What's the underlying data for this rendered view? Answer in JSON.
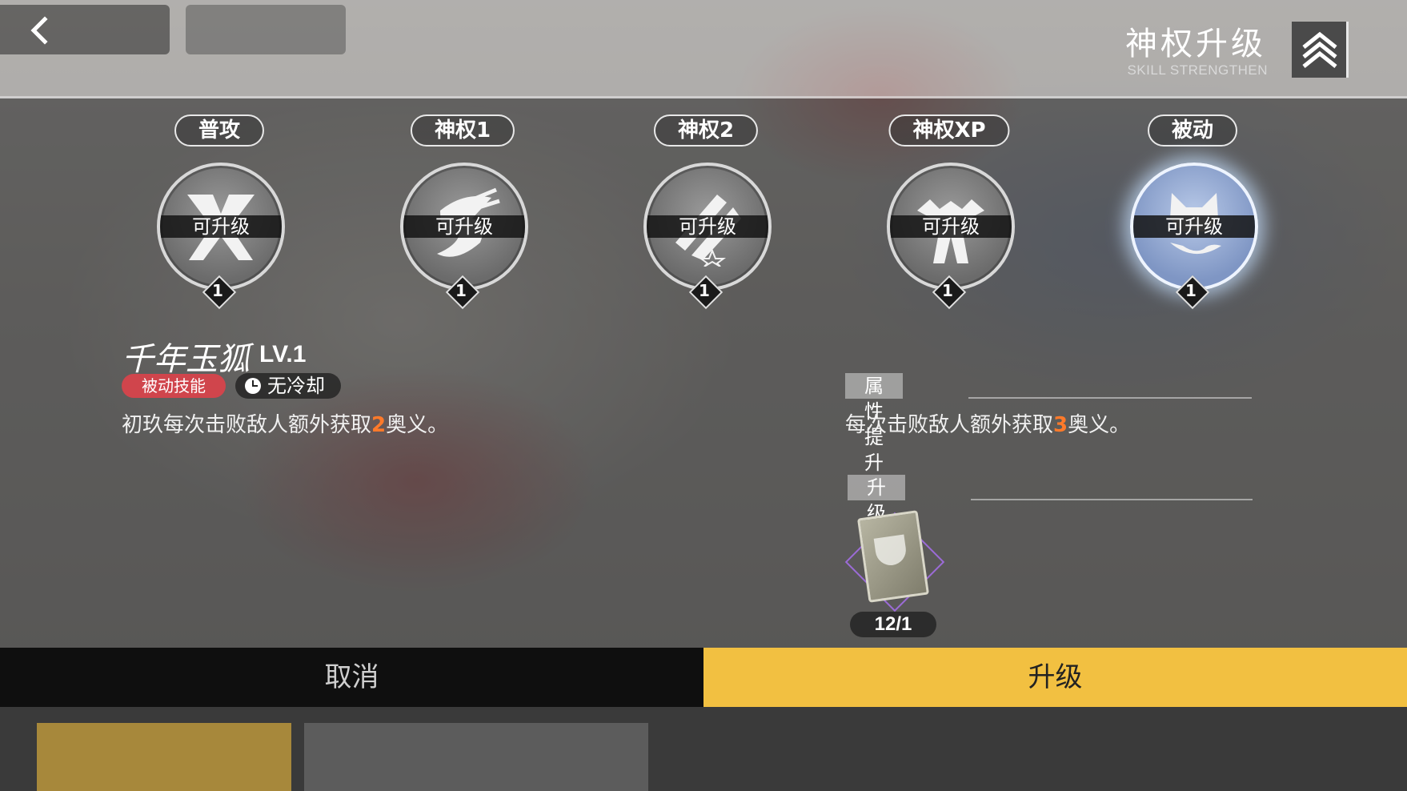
{
  "header": {
    "title": "神权升级",
    "subtitle": "SKILL STRENGTHEN"
  },
  "skills": [
    {
      "label": "普攻",
      "status": "可升级",
      "level": "1",
      "icon": "crossed-blades-icon"
    },
    {
      "label": "神权1",
      "status": "可升级",
      "level": "1",
      "icon": "fox-dash-icon"
    },
    {
      "label": "神权2",
      "status": "可升级",
      "level": "1",
      "icon": "twin-beam-icon"
    },
    {
      "label": "神权XP",
      "status": "可升级",
      "level": "1",
      "icon": "fox-burst-icon"
    },
    {
      "label": "被动",
      "status": "可升级",
      "level": "1",
      "icon": "fox-head-icon",
      "selected": true
    }
  ],
  "detail": {
    "name": "千年玉狐",
    "level": "LV.1",
    "type_tag": "被动技能",
    "cooldown": "无冷却",
    "desc_pre": "初玖每次击败敌人额外获取",
    "desc_value": "2",
    "desc_post": "奥义。"
  },
  "upgrade": {
    "attr_header": "属性提升",
    "attr_pre": "每次击败敌人额外获取",
    "attr_value": "3",
    "attr_post": "奥义。",
    "cost_header": "升级消耗",
    "cost_item_icon": "skill-book-icon",
    "cost_count": "12/1"
  },
  "buttons": {
    "cancel": "取消",
    "upgrade": "升级"
  },
  "colors": {
    "accent_yellow": "#f2c041",
    "highlight_orange": "#ff7a2a",
    "passive_tag_red": "#d0454c"
  }
}
